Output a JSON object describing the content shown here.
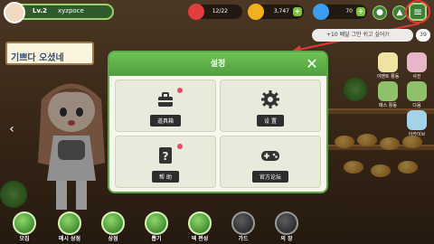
{
  "player": {
    "level": "Lv.2",
    "name": "xyzpoce"
  },
  "resources": [
    {
      "name": "stamina",
      "value": "12/22",
      "color": "#e23c3c"
    },
    {
      "name": "gold",
      "value": "3,747",
      "color": "#f2b01e"
    },
    {
      "name": "gems",
      "value": "70",
      "color": "#3b9df0"
    }
  ],
  "banner": {
    "text": "기쁘다 오셨네"
  },
  "notice": {
    "text": "+10 배달 그만 쉬고 싶어?!",
    "badge": "39"
  },
  "side_menu": [
    {
      "label": "이벤트 활동",
      "icon": "event-icon",
      "color": "#f0e3a1"
    },
    {
      "label": "사진",
      "icon": "photo-icon",
      "color": "#e7b7c9"
    },
    {
      "label": "매스 활동",
      "icon": "activity-icon",
      "color": "#8fc06a"
    },
    {
      "label": "다음",
      "icon": "next-icon",
      "color": "#8fc06a"
    },
    {
      "label": "아카이브",
      "icon": "archive-icon",
      "color": "#a3d3e8"
    }
  ],
  "modal": {
    "title": "설정",
    "tiles": [
      {
        "label": "道具箱",
        "icon": "toolbox-icon"
      },
      {
        "label": "设 置",
        "icon": "gear-icon"
      },
      {
        "label": "帮 助",
        "icon": "help-book-icon"
      },
      {
        "label": "官方论坛",
        "icon": "gamepad-icon"
      }
    ]
  },
  "bottom_nav": [
    {
      "label": "모집",
      "icon": "recruit-icon"
    },
    {
      "label": "메시 상점",
      "icon": "shop-icon"
    },
    {
      "label": "상점",
      "icon": "store-icon"
    },
    {
      "label": "뽑기",
      "icon": "gacha-icon"
    },
    {
      "label": "덱 편성",
      "icon": "deck-icon"
    },
    {
      "label": "가드",
      "icon": "guard-icon"
    },
    {
      "label": "의 장",
      "icon": "equip-icon"
    }
  ]
}
